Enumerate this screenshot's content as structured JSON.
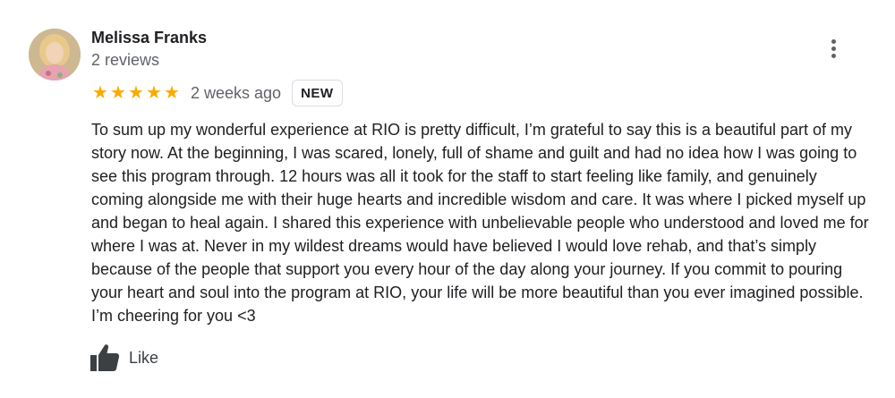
{
  "reviewer": {
    "name": "Melissa Franks",
    "review_count": "2 reviews",
    "avatar_icon": "profile-photo"
  },
  "rating": {
    "stars": 5,
    "max_stars": 5,
    "star_glyph": "★",
    "star_color": "#f9ab00"
  },
  "date": "2 weeks ago",
  "badge": "NEW",
  "review_text": "To sum up my wonderful experience at RIO is pretty difficult, I’m grateful to say this is a beautiful part of my story now. At the beginning, I was scared, lonely, full of shame and guilt and had no idea how I was going to see this program through. 12 hours was all it took for the staff to start feeling like family, and genuinely coming alongside me with their huge hearts and incredible wisdom and care. It was where I picked myself up and began to heal again. I shared this experience with unbelievable people who understood and loved me for where I was at. Never in my wildest dreams would have believed I would love rehab, and that’s simply because of the people that support you every hour of the day along your journey. If you commit to pouring your heart and soul into the program at RIO, your life will be more beautiful than you ever imagined possible. I’m cheering for you <3",
  "actions": {
    "like_label": "Like",
    "like_icon": "thumbs-up-icon",
    "more_icon": "more-vert-icon"
  }
}
